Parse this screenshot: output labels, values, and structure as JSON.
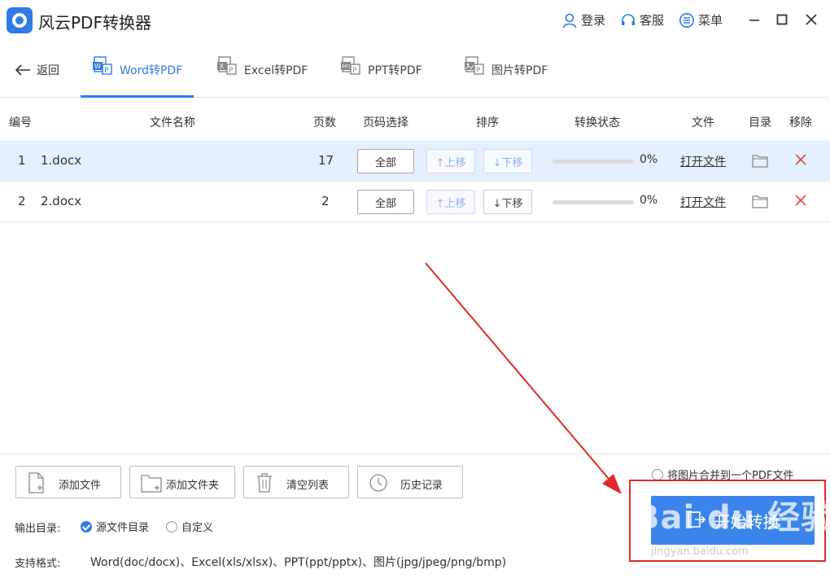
{
  "app": {
    "title": "风云PDF转换器",
    "login": "登录",
    "service": "客服",
    "menu": "菜单"
  },
  "nav": {
    "back": "返回",
    "tabs": [
      {
        "label": "Word转PDF",
        "active": true
      },
      {
        "label": "Excel转PDF",
        "active": false
      },
      {
        "label": "PPT转PDF",
        "active": false
      },
      {
        "label": "图片转PDF",
        "active": false
      }
    ]
  },
  "table": {
    "headers": {
      "index": "编号",
      "name": "文件名称",
      "pages": "页数",
      "page_select": "页码选择",
      "order": "排序",
      "status": "转换状态",
      "file": "文件",
      "dir": "目录",
      "remove": "移除"
    },
    "rows": [
      {
        "index": "1",
        "name": "1.docx",
        "pages": "17",
        "page_select": "全部",
        "up": "↑上移",
        "down": "↓下移",
        "progress": 0,
        "percent": "0%",
        "open": "打开文件"
      },
      {
        "index": "2",
        "name": "2.docx",
        "pages": "2",
        "page_select": "全部",
        "up": "↑上移",
        "down": "↓下移",
        "progress": 0,
        "percent": "0%",
        "open": "打开文件"
      }
    ]
  },
  "actions": {
    "add_file": "添加文件",
    "add_folder": "添加文件夹",
    "clear_list": "清空列表",
    "history": "历史记录"
  },
  "output": {
    "label": "输出目录:",
    "option_source": "源文件目录",
    "option_custom": "自定义",
    "selected": "source"
  },
  "formats": {
    "label": "支持格式:",
    "text": "Word(doc/docx)、Excel(xls/xlsx)、PPT(ppt/pptx)、图片(jpg/jpeg/png/bmp)"
  },
  "merge_images": "将图片合并到一个PDF文件",
  "start": "开始转换",
  "watermark": {
    "main": "Bai du 经验",
    "sub": "jingyan.baidu.com"
  },
  "colors": {
    "accent": "#2f7be8",
    "highlight": "#e02a2a",
    "selected_row": "#e4efff"
  }
}
